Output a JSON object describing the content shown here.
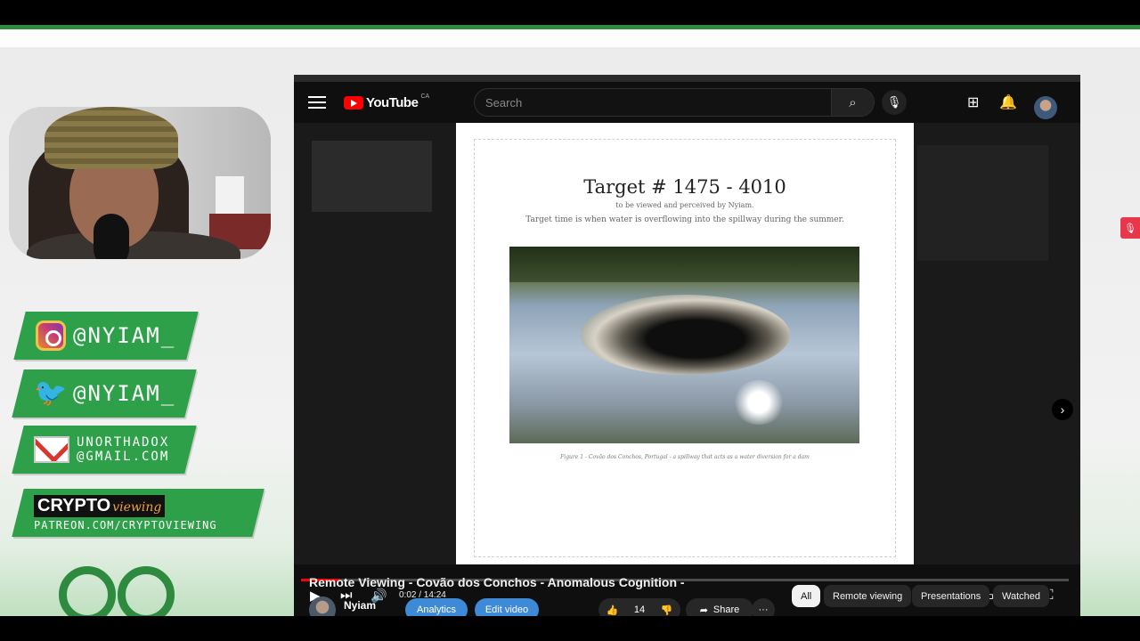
{
  "social": {
    "instagram": "@NYIAM_",
    "twitter": "@NYIAM_",
    "email_line1": "UNORTHADOX",
    "email_line2": "@GMAIL.COM",
    "crypto_word": "CRYPTO",
    "viewing_word": "viewing",
    "patreon": "PATREON.COM/CRYPTOVIEWING"
  },
  "youtube": {
    "logo_text": "YouTube",
    "country_code": "CA",
    "search_placeholder": "Search",
    "icons": [
      "menu-icon",
      "search-icon",
      "mic-icon",
      "create-icon",
      "bell-icon"
    ]
  },
  "document": {
    "title": "Target # 1475 - 4010",
    "subtitle": "to be viewed and perceived by Nyiam.",
    "note": "Target time is when water is overflowing into the spillway during the summer.",
    "caption": "Figure 1 - Covão dos Conchos, Portugal - a spillway that acts as a water diversion for a dam"
  },
  "player": {
    "time": "0:02 / 14:24",
    "progress_fraction": 0.05
  },
  "video": {
    "title": "Remote Viewing - Covão dos Conchos - Anomalous Cognition -",
    "channel": "Nyiam",
    "analytics_label": "Analytics",
    "edit_label": "Edit video",
    "likes": "14",
    "share_label": "Share",
    "more_label": "···"
  },
  "chips": [
    "All",
    "Remote viewing",
    "Presentations",
    "Watched"
  ],
  "colors": {
    "accent_green": "#2d8a3e",
    "youtube_red": "#ff0000",
    "button_blue": "#3e8ad6"
  }
}
